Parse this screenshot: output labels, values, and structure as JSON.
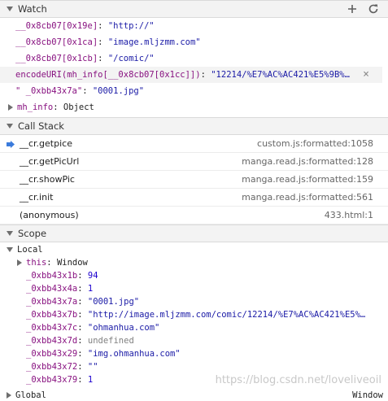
{
  "watch": {
    "title": "Watch",
    "add_icon": "plus-icon",
    "refresh_icon": "refresh-icon",
    "items": [
      {
        "key": "__0x8cb07[0x19e]",
        "value": "\"http://\""
      },
      {
        "key": "__0x8cb07[0x1ca]",
        "value": "\"image.mljzmm.com\""
      },
      {
        "key": "__0x8cb07[0x1cb]",
        "value": "\"/comic/\""
      },
      {
        "key": "encodeURI(mh_info[__0x8cb07[0x1cc]])",
        "value": "\"12214/%E7%AC%AC421%E5%9B%…"
      },
      {
        "key": "\" _0xbb43x7a\"",
        "value": "\"0001.jpg\""
      }
    ],
    "object_row": {
      "key": "mh_info",
      "value": "Object"
    }
  },
  "callstack": {
    "title": "Call Stack",
    "frames": [
      {
        "fn": "__cr.getpice",
        "loc": "custom.js:formatted:1058",
        "current": true
      },
      {
        "fn": "__cr.getPicUrl",
        "loc": "manga.read.js:formatted:128",
        "current": false
      },
      {
        "fn": "__cr.showPic",
        "loc": "manga.read.js:formatted:159",
        "current": false
      },
      {
        "fn": "__cr.init",
        "loc": "manga.read.js:formatted:561",
        "current": false
      },
      {
        "fn": "(anonymous)",
        "loc": "433.html:1",
        "current": false
      }
    ]
  },
  "scope": {
    "title": "Scope",
    "local_label": "Local",
    "this_row": {
      "key": "this",
      "value": "Window"
    },
    "vars": [
      {
        "key": "_0xbb43x1b",
        "value": "94",
        "kind": "num"
      },
      {
        "key": "_0xbb43x4a",
        "value": "1",
        "kind": "num"
      },
      {
        "key": "_0xbb43x7a",
        "value": "\"0001.jpg\"",
        "kind": "str"
      },
      {
        "key": "_0xbb43x7b",
        "value": "\"http://image.mljzmm.com/comic/12214/%E7%AC%AC421%E5%…",
        "kind": "str"
      },
      {
        "key": "_0xbb43x7c",
        "value": "\"ohmanhua.com\"",
        "kind": "str"
      },
      {
        "key": "_0xbb43x7d",
        "value": "undefined",
        "kind": "undef"
      },
      {
        "key": "_0xbb43x29",
        "value": "\"img.ohmanhua.com\"",
        "kind": "str"
      },
      {
        "key": "_0xbb43x72",
        "value": "\"\"",
        "kind": "str"
      },
      {
        "key": "_0xbb43x79",
        "value": "1",
        "kind": "num"
      }
    ],
    "global_label": "Global",
    "global_value": "Window"
  },
  "watermark": "https://blog.csdn.net/loveliveoil"
}
